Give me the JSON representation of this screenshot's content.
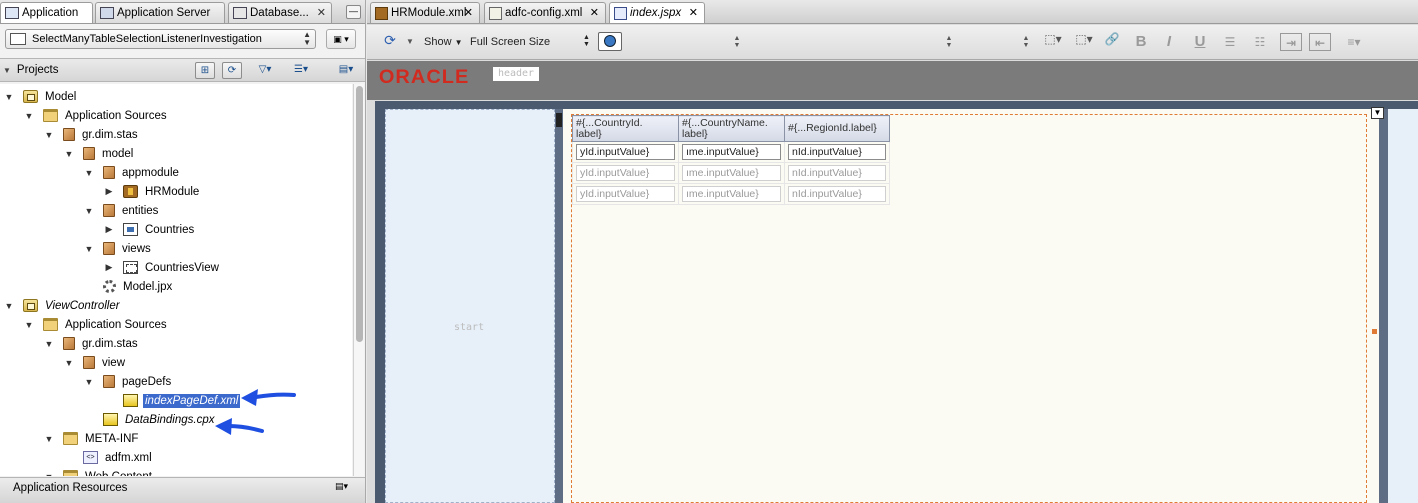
{
  "left": {
    "tabs": [
      {
        "label": "Application",
        "icon": "application-navigator-icon"
      },
      {
        "label": "Application Server",
        "icon": "application-server-icon"
      },
      {
        "label": "Database...",
        "icon": "database-icon"
      }
    ],
    "app_selector": "SelectManyTableSelectionListenerInvestigation",
    "projects_label": "Projects",
    "tree": [
      {
        "label": "Model",
        "level": 0,
        "expanded": true,
        "icon": "project-icon"
      },
      {
        "label": "Application Sources",
        "level": 1,
        "expanded": true,
        "icon": "folder-icon"
      },
      {
        "label": "gr.dim.stas",
        "level": 2,
        "expanded": true,
        "icon": "package-icon"
      },
      {
        "label": "model",
        "level": 3,
        "expanded": true,
        "icon": "package-icon"
      },
      {
        "label": "appmodule",
        "level": 4,
        "expanded": true,
        "icon": "package-icon"
      },
      {
        "label": "HRModule",
        "level": 5,
        "expanded": false,
        "icon": "application-module-icon"
      },
      {
        "label": "entities",
        "level": 4,
        "expanded": true,
        "icon": "package-icon"
      },
      {
        "label": "Countries",
        "level": 5,
        "expanded": false,
        "icon": "entity-object-icon"
      },
      {
        "label": "views",
        "level": 4,
        "expanded": true,
        "icon": "package-icon"
      },
      {
        "label": "CountriesView",
        "level": 5,
        "expanded": false,
        "icon": "view-object-icon"
      },
      {
        "label": "Model.jpx",
        "level": 4,
        "leaf": true,
        "icon": "gear-icon"
      },
      {
        "label": "ViewController",
        "level": 0,
        "expanded": true,
        "italic": true,
        "icon": "project-icon"
      },
      {
        "label": "Application Sources",
        "level": 1,
        "expanded": true,
        "icon": "folder-icon"
      },
      {
        "label": "gr.dim.stas",
        "level": 2,
        "expanded": true,
        "icon": "package-icon"
      },
      {
        "label": "view",
        "level": 3,
        "expanded": true,
        "icon": "package-icon"
      },
      {
        "label": "pageDefs",
        "level": 4,
        "expanded": true,
        "icon": "package-icon"
      },
      {
        "label": "indexPageDef.xml",
        "level": 5,
        "leaf": true,
        "italic": true,
        "selected": true,
        "icon": "page-definition-icon"
      },
      {
        "label": "DataBindings.cpx",
        "level": 4,
        "leaf": true,
        "italic": true,
        "icon": "page-definition-icon"
      },
      {
        "label": "META-INF",
        "level": 2,
        "expanded": true,
        "icon": "folder-icon"
      },
      {
        "label": "adfm.xml",
        "level": 3,
        "leaf": true,
        "icon": "xml-file-icon"
      },
      {
        "label": "Web Content",
        "level": 2,
        "expanded": true,
        "icon": "folder-icon"
      }
    ],
    "resources_label": "Application Resources"
  },
  "editor": {
    "tabs": [
      {
        "label": "HRModule.xml",
        "active": false
      },
      {
        "label": "adfc-config.xml",
        "active": false
      },
      {
        "label": "index.jspx",
        "active": true
      }
    ],
    "toolbar": {
      "show_label": "Show",
      "screen_size": "Full Screen Size"
    },
    "brand": "ORACLE",
    "header_facet": "header",
    "start_facet": "start",
    "table": {
      "columns": [
        "#{...CountryId.\nlabel}",
        "#{...CountryName.\nlabel}",
        "#{...RegionId.label}"
      ],
      "rows": [
        [
          "yId.inputValue}",
          "ıme.inputValue}",
          "nId.inputValue}"
        ],
        [
          "yId.inputValue}",
          "ıme.inputValue}",
          "nId.inputValue}"
        ],
        [
          "yId.inputValue}",
          "ıme.inputValue}",
          "nId.inputValue}"
        ]
      ]
    }
  },
  "colors": {
    "selection": "#3c69cc",
    "oracle_red": "#d12a1f",
    "annotation_arrow": "#1f4fe0",
    "canvas_frame": "#4b5a6f"
  }
}
